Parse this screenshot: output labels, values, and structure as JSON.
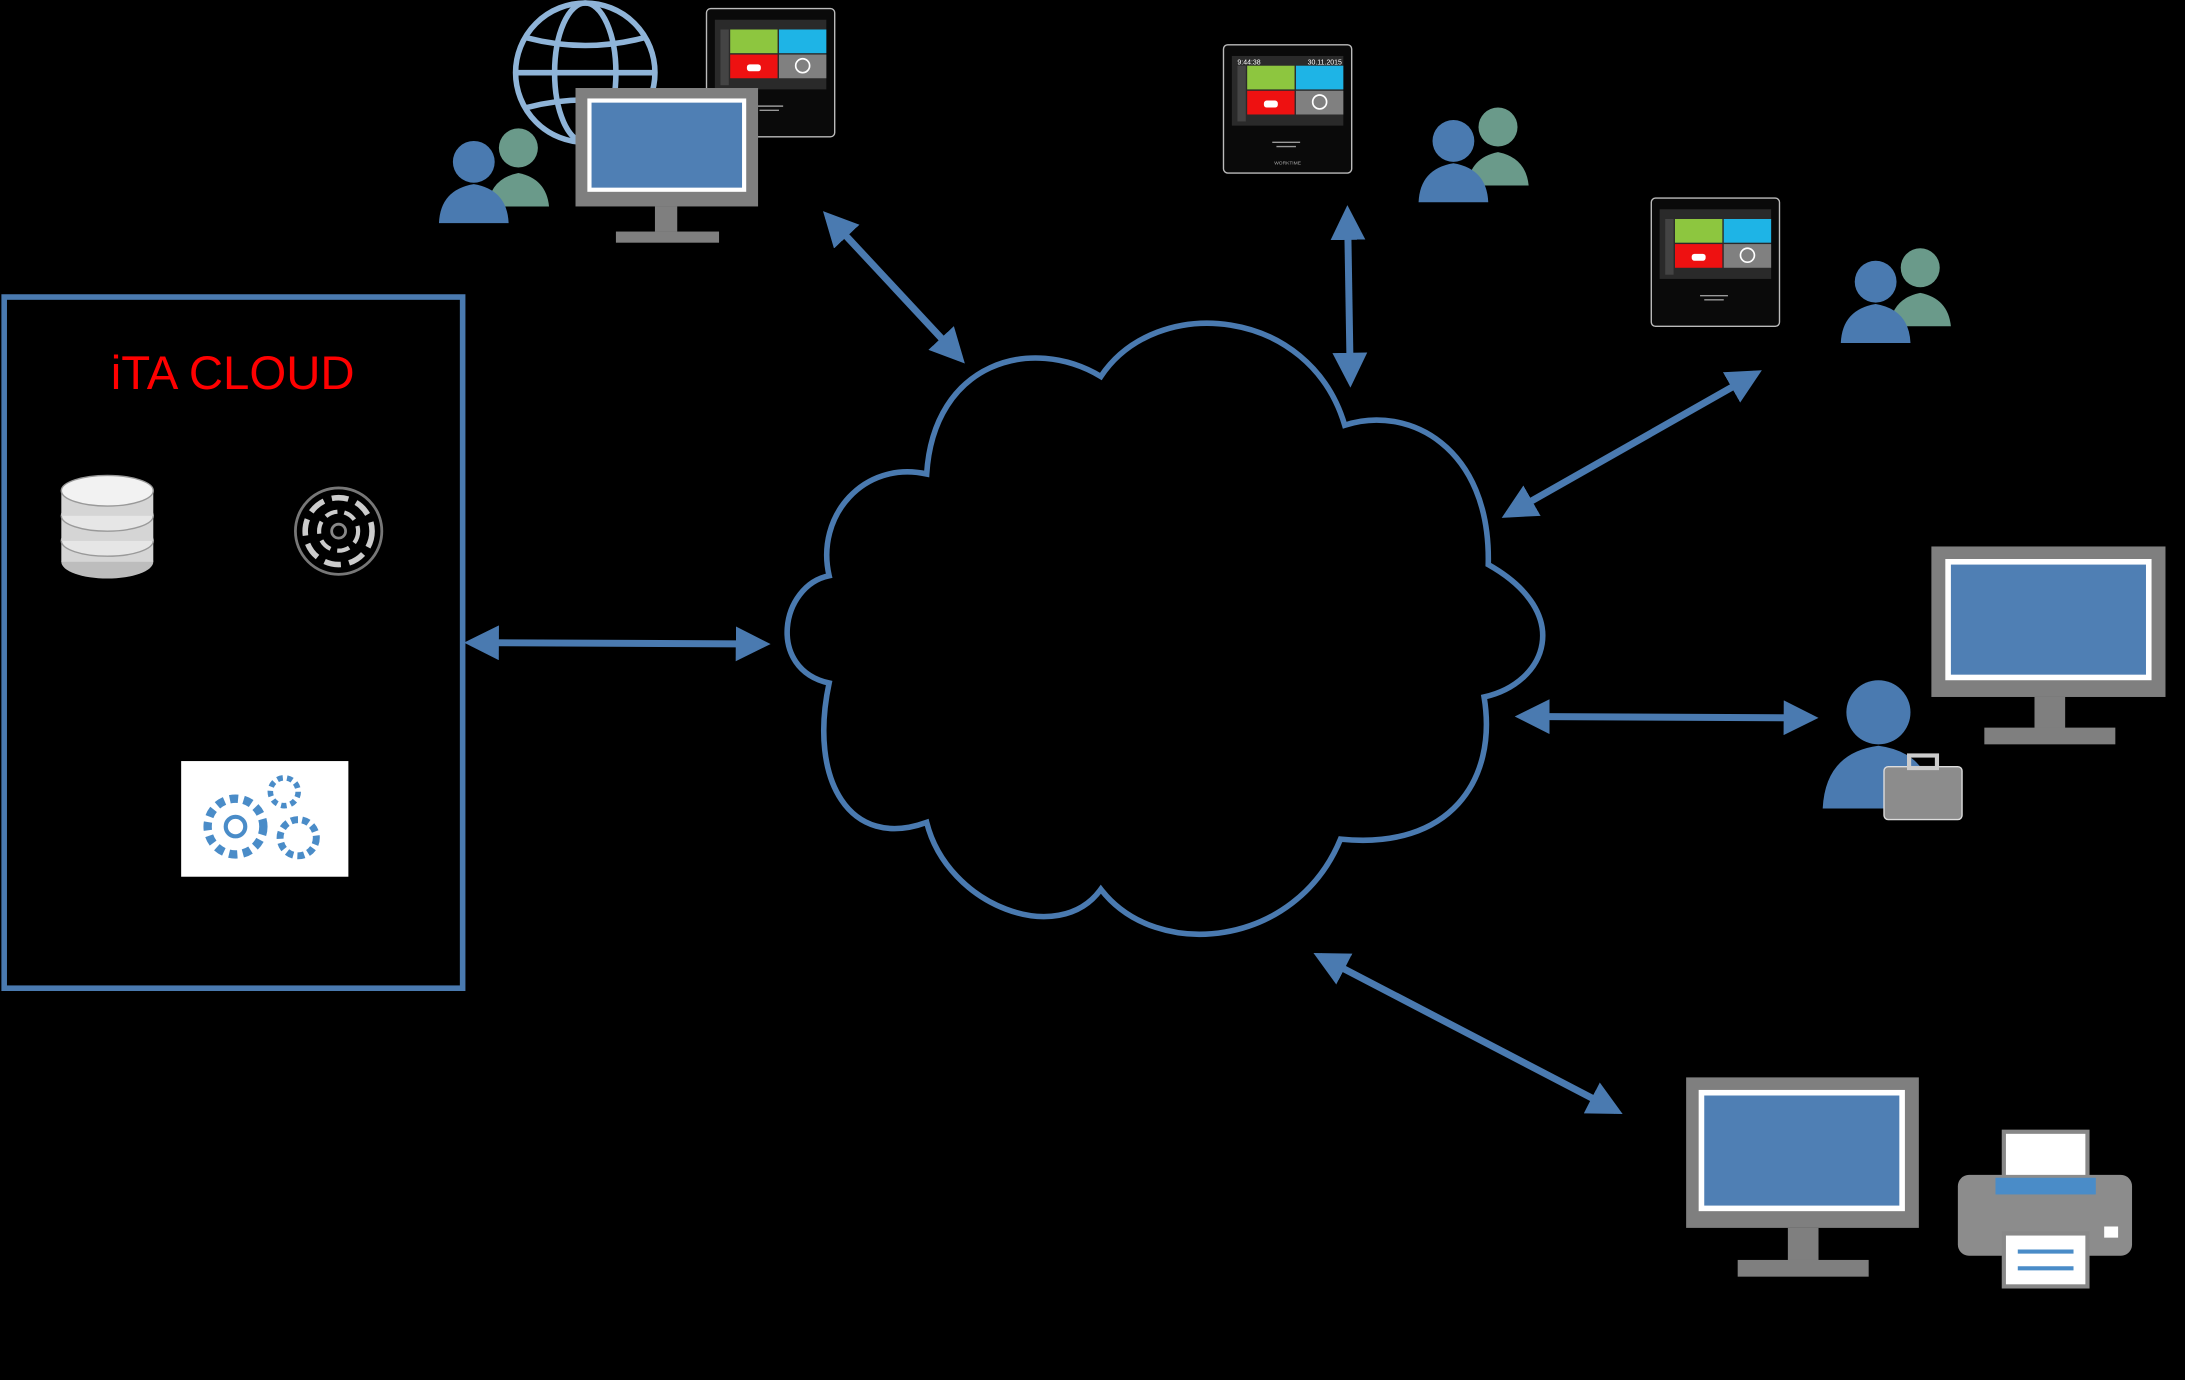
{
  "cloud_box": {
    "title": "iTA CLOUD",
    "title_color": "#ff0000",
    "border_color": "#4a7ab0"
  },
  "terminal": {
    "time": "9:44:38",
    "date": "30.11.2015",
    "brand": "WORKTIME"
  },
  "colors": {
    "accent": "#4a7ab0",
    "monitor_frame": "#7f7f7f",
    "screen": "#4f7fb4",
    "user_primary": "#4a7ab0",
    "user_secondary": "#6a9a8a",
    "tile_green": "#8dc63f",
    "tile_blue": "#1eb4e6",
    "tile_red": "#ee1111",
    "tile_gray": "#808080"
  },
  "icons": [
    "globe-icon",
    "terminal-icon",
    "monitor-icon",
    "users-icon",
    "database-icon",
    "dial-icon",
    "gears-icon",
    "business-user-icon",
    "printer-icon",
    "cloud-icon",
    "double-arrow-icon"
  ]
}
